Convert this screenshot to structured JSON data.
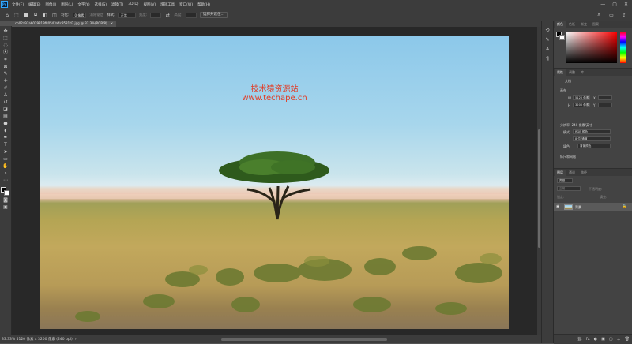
{
  "app": {
    "logo": "Ps"
  },
  "menu": [
    "文件(F)",
    "编辑(E)",
    "图像(I)",
    "图层(L)",
    "文字(Y)",
    "选择(S)",
    "滤镜(T)",
    "3D(D)",
    "视图(V)",
    "增效工具",
    "窗口(W)",
    "帮助(H)"
  ],
  "window_controls": {
    "minimize": "—",
    "maximize": "▢",
    "close": "✕"
  },
  "options": {
    "feather_label": "羽化:",
    "feather_value": "0 像素",
    "antialias_label": "消除锯齿",
    "style_label": "样式:",
    "style_value": "正常",
    "width_label": "宽度:",
    "height_label": "高度:",
    "select_mask_label": "选择并遮住..."
  },
  "document": {
    "tab_label": "cb02a93a6029819f80543a4c8581d3.jpg @ 33.3%(RGB/8)",
    "close": "×"
  },
  "watermark": {
    "title": "技术猿资源站",
    "url": "www.techape.cn"
  },
  "status": {
    "text": "33.33%   5120 像素 x 3200 像素 (240 ppi)",
    "arrow": "›"
  },
  "color_panel": {
    "tabs": [
      "颜色",
      "色板",
      "渐变",
      "图案"
    ]
  },
  "properties_panel": {
    "tabs": [
      "属性",
      "调整",
      "库"
    ],
    "doc_label": "文档",
    "canvas_label": "画布",
    "w_label": "W",
    "w_value": "5120 像素",
    "h_label": "H",
    "h_value": "3200 像素",
    "x_label": "X",
    "y_label": "Y",
    "resolution": "分辨率: 240 像素/英寸",
    "mode_label": "模式",
    "mode_value": "RGB 颜色",
    "depth_value": "8 位/通道",
    "fill_label": "填色",
    "fill_value": "背景颜色",
    "rulers_label": "标尺和网格"
  },
  "layers_panel": {
    "tabs": [
      "图层",
      "通道",
      "路径"
    ],
    "filter_label": "类型",
    "mode_value": "正常",
    "opacity_label": "不透明度:",
    "lock_label": "锁定:",
    "fill_label": "填充:",
    "layer_name": "背景",
    "eye": "◉",
    "lock": "🔒",
    "footer_icons": [
      "⛓",
      "fx",
      "◐",
      "▣",
      "▢",
      "＋",
      "🗑"
    ]
  }
}
